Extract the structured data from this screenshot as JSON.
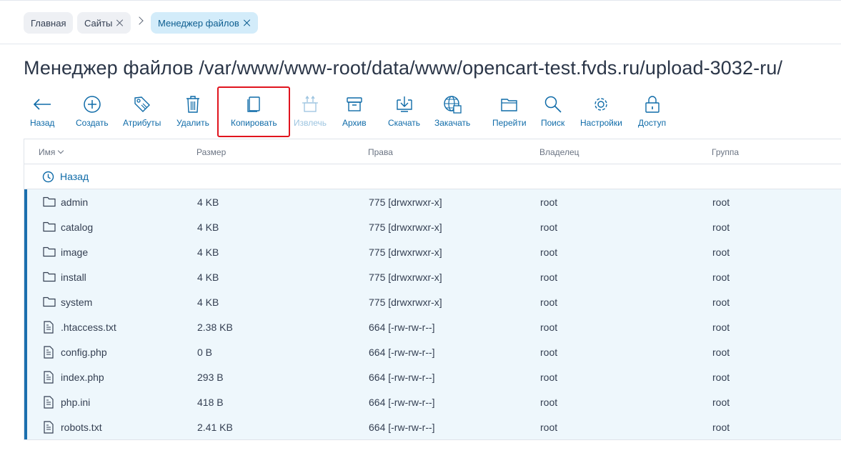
{
  "breadcrumbs": [
    {
      "label": "Главная"
    },
    {
      "label": "Сайты"
    },
    {
      "label": "Менеджер файлов"
    }
  ],
  "page": {
    "title": "Менеджер файлов /var/www/www-root/data/www/opencart-test.fvds.ru/upload-3032-ru/"
  },
  "toolbar": {
    "back": "Назад",
    "create": "Создать",
    "attributes": "Атрибуты",
    "delete": "Удалить",
    "copy": "Копировать",
    "extract": "Извлечь",
    "archive": "Архив",
    "download": "Скачать",
    "upload": "Закачать",
    "goto": "Перейти",
    "search": "Поиск",
    "settings": "Настройки",
    "access": "Доступ"
  },
  "table": {
    "headers": {
      "name": "Имя",
      "size": "Размер",
      "perms": "Права",
      "owner": "Владелец",
      "group": "Группа"
    },
    "back_label": "Назад",
    "rows": [
      {
        "type": "folder",
        "name": "admin",
        "size": "4 KB",
        "perms": "775 [drwxrwxr-x]",
        "owner": "root",
        "group": "root"
      },
      {
        "type": "folder",
        "name": "catalog",
        "size": "4 KB",
        "perms": "775 [drwxrwxr-x]",
        "owner": "root",
        "group": "root"
      },
      {
        "type": "folder",
        "name": "image",
        "size": "4 KB",
        "perms": "775 [drwxrwxr-x]",
        "owner": "root",
        "group": "root"
      },
      {
        "type": "folder",
        "name": "install",
        "size": "4 KB",
        "perms": "775 [drwxrwxr-x]",
        "owner": "root",
        "group": "root"
      },
      {
        "type": "folder",
        "name": "system",
        "size": "4 KB",
        "perms": "775 [drwxrwxr-x]",
        "owner": "root",
        "group": "root"
      },
      {
        "type": "file",
        "name": ".htaccess.txt",
        "size": "2.38 KB",
        "perms": "664 [-rw-rw-r--]",
        "owner": "root",
        "group": "root"
      },
      {
        "type": "file",
        "name": "config.php",
        "size": "0 B",
        "perms": "664 [-rw-rw-r--]",
        "owner": "root",
        "group": "root"
      },
      {
        "type": "file",
        "name": "index.php",
        "size": "293 B",
        "perms": "664 [-rw-rw-r--]",
        "owner": "root",
        "group": "root"
      },
      {
        "type": "file",
        "name": "php.ini",
        "size": "418 B",
        "perms": "664 [-rw-rw-r--]",
        "owner": "root",
        "group": "root"
      },
      {
        "type": "file",
        "name": "robots.txt",
        "size": "2.41 KB",
        "perms": "664 [-rw-rw-r--]",
        "owner": "root",
        "group": "root"
      }
    ]
  },
  "colors": {
    "accent": "#0f6ba8",
    "highlight": "#e0141e",
    "selected_row": "#eef7fc"
  }
}
